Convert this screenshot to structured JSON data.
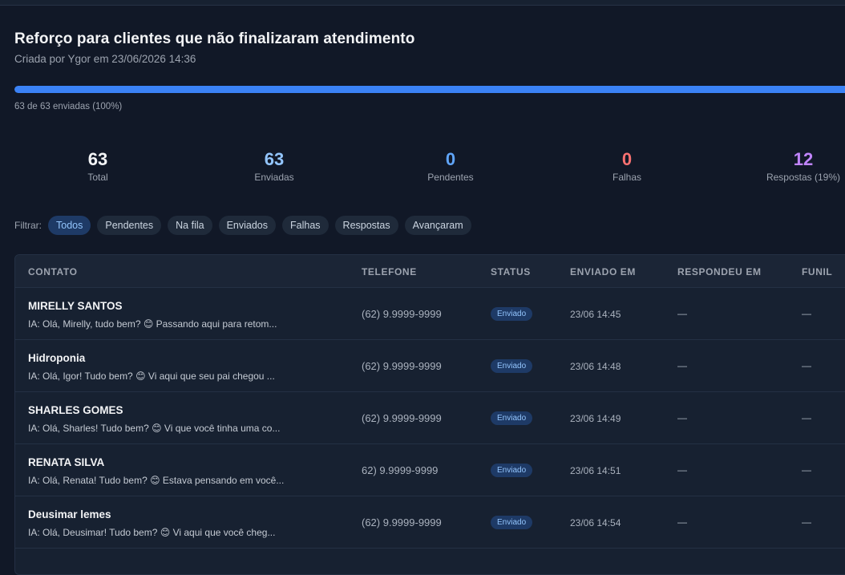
{
  "campaign": {
    "title": "Reforço para clientes que não finalizaram atendimento",
    "subtitle": "Criada por Ygor em 23/06/2026 14:36",
    "progress_fraction": 1.0,
    "progress_text": "63 de 63 enviadas (100%)"
  },
  "stats": [
    {
      "value": "63",
      "label": "Total",
      "color": "#f3f4f6"
    },
    {
      "value": "63",
      "label": "Enviadas",
      "color": "#93c5fd"
    },
    {
      "value": "0",
      "label": "Pendentes",
      "color": "#60a5fa"
    },
    {
      "value": "0",
      "label": "Falhas",
      "color": "#f87171"
    },
    {
      "value": "12",
      "label": "Respostas (19%)",
      "color": "#c084fc"
    }
  ],
  "filters": {
    "label": "Filtrar:",
    "options": [
      "Todos",
      "Pendentes",
      "Na fila",
      "Enviados",
      "Falhas",
      "Respostas",
      "Avançaram"
    ],
    "active": "Todos"
  },
  "table": {
    "columns": [
      "CONTATO",
      "TELEFONE",
      "STATUS",
      "ENVIADO EM",
      "RESPONDEU EM",
      "FUNIL"
    ],
    "rows": [
      {
        "name": "MIRELLY SANTOS",
        "message": "IA: Olá, Mirelly, tudo bem? 😊 Passando aqui para retom...",
        "phone": "(62) 9.9999-9999",
        "status": "Enviado",
        "sent": "23/06 14:45",
        "responded": "—",
        "funnel": "—"
      },
      {
        "name": "Hidroponia",
        "message": "IA: Olá, Igor! Tudo bem? 😊 Vi aqui que seu pai chegou ...",
        "phone": "(62) 9.9999-9999",
        "status": "Enviado",
        "sent": "23/06 14:48",
        "responded": "—",
        "funnel": "—"
      },
      {
        "name": "SHARLES GOMES",
        "message": "IA: Olá, Sharles! Tudo bem? 😊 Vi que você tinha uma co...",
        "phone": "(62) 9.9999-9999",
        "status": "Enviado",
        "sent": "23/06 14:49",
        "responded": "—",
        "funnel": "—"
      },
      {
        "name": "RENATA SILVA",
        "message": "IA: Olá, Renata! Tudo bem? 😊 Estava pensando em você...",
        "phone": "62) 9.9999-9999",
        "status": "Enviado",
        "sent": "23/06 14:51",
        "responded": "—",
        "funnel": "—"
      },
      {
        "name": "Deusimar lemes",
        "message": "IA: Olá, Deusimar! Tudo bem? 😊 Vi aqui que você cheg...",
        "phone": "(62) 9.9999-9999",
        "status": "Enviado",
        "sent": "23/06 14:54",
        "responded": "—",
        "funnel": "—"
      }
    ]
  }
}
